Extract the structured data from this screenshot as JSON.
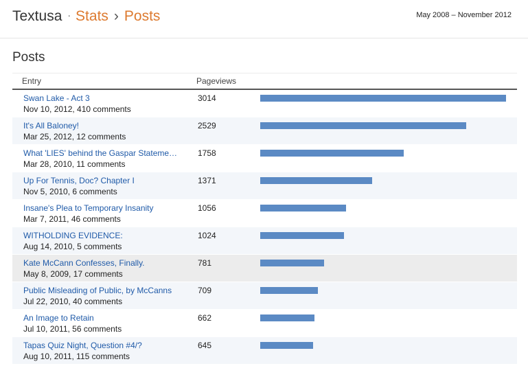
{
  "header": {
    "blog_name": "Textusa",
    "separator_dot": "·",
    "crumb_stats": "Stats",
    "crumb_sep": "›",
    "crumb_posts": "Posts",
    "date_range": "May 2008 – November 2012"
  },
  "section": {
    "title": "Posts",
    "col_entry": "Entry",
    "col_pageviews": "Pageviews"
  },
  "colors": {
    "bar": "#5b8ac4",
    "link": "#1f5aa8",
    "accent": "#dd7a2f"
  },
  "chart_data": {
    "type": "bar",
    "max_value": 3014,
    "rows": [
      {
        "title": "Swan Lake - Act 3",
        "meta": "Nov 10, 2012, 410 comments",
        "pageviews": 3014
      },
      {
        "title": "It's All Baloney!",
        "meta": "Mar 25, 2012, 12 comments",
        "pageviews": 2529
      },
      {
        "title": "What 'LIES' behind the Gaspar Statements?",
        "meta": "Mar 28, 2010, 11 comments",
        "pageviews": 1758
      },
      {
        "title": "Up For Tennis, Doc? Chapter I",
        "meta": "Nov 5, 2010, 6 comments",
        "pageviews": 1371
      },
      {
        "title": "Insane's Plea to Temporary Insanity",
        "meta": "Mar 7, 2011, 46 comments",
        "pageviews": 1056
      },
      {
        "title": "WITHOLDING EVIDENCE:",
        "meta": "Aug 14, 2010, 5 comments",
        "pageviews": 1024
      },
      {
        "title": "Kate McCann Confesses, Finally.",
        "meta": "May 8, 2009, 17 comments",
        "pageviews": 781
      },
      {
        "title": "Public Misleading of Public, by McCanns",
        "meta": "Jul 22, 2010, 40 comments",
        "pageviews": 709
      },
      {
        "title": "An Image to Retain",
        "meta": "Jul 10, 2011, 56 comments",
        "pageviews": 662
      },
      {
        "title": "Tapas Quiz Night, Question #4/?",
        "meta": "Aug 10, 2011, 115 comments",
        "pageviews": 645
      }
    ]
  }
}
